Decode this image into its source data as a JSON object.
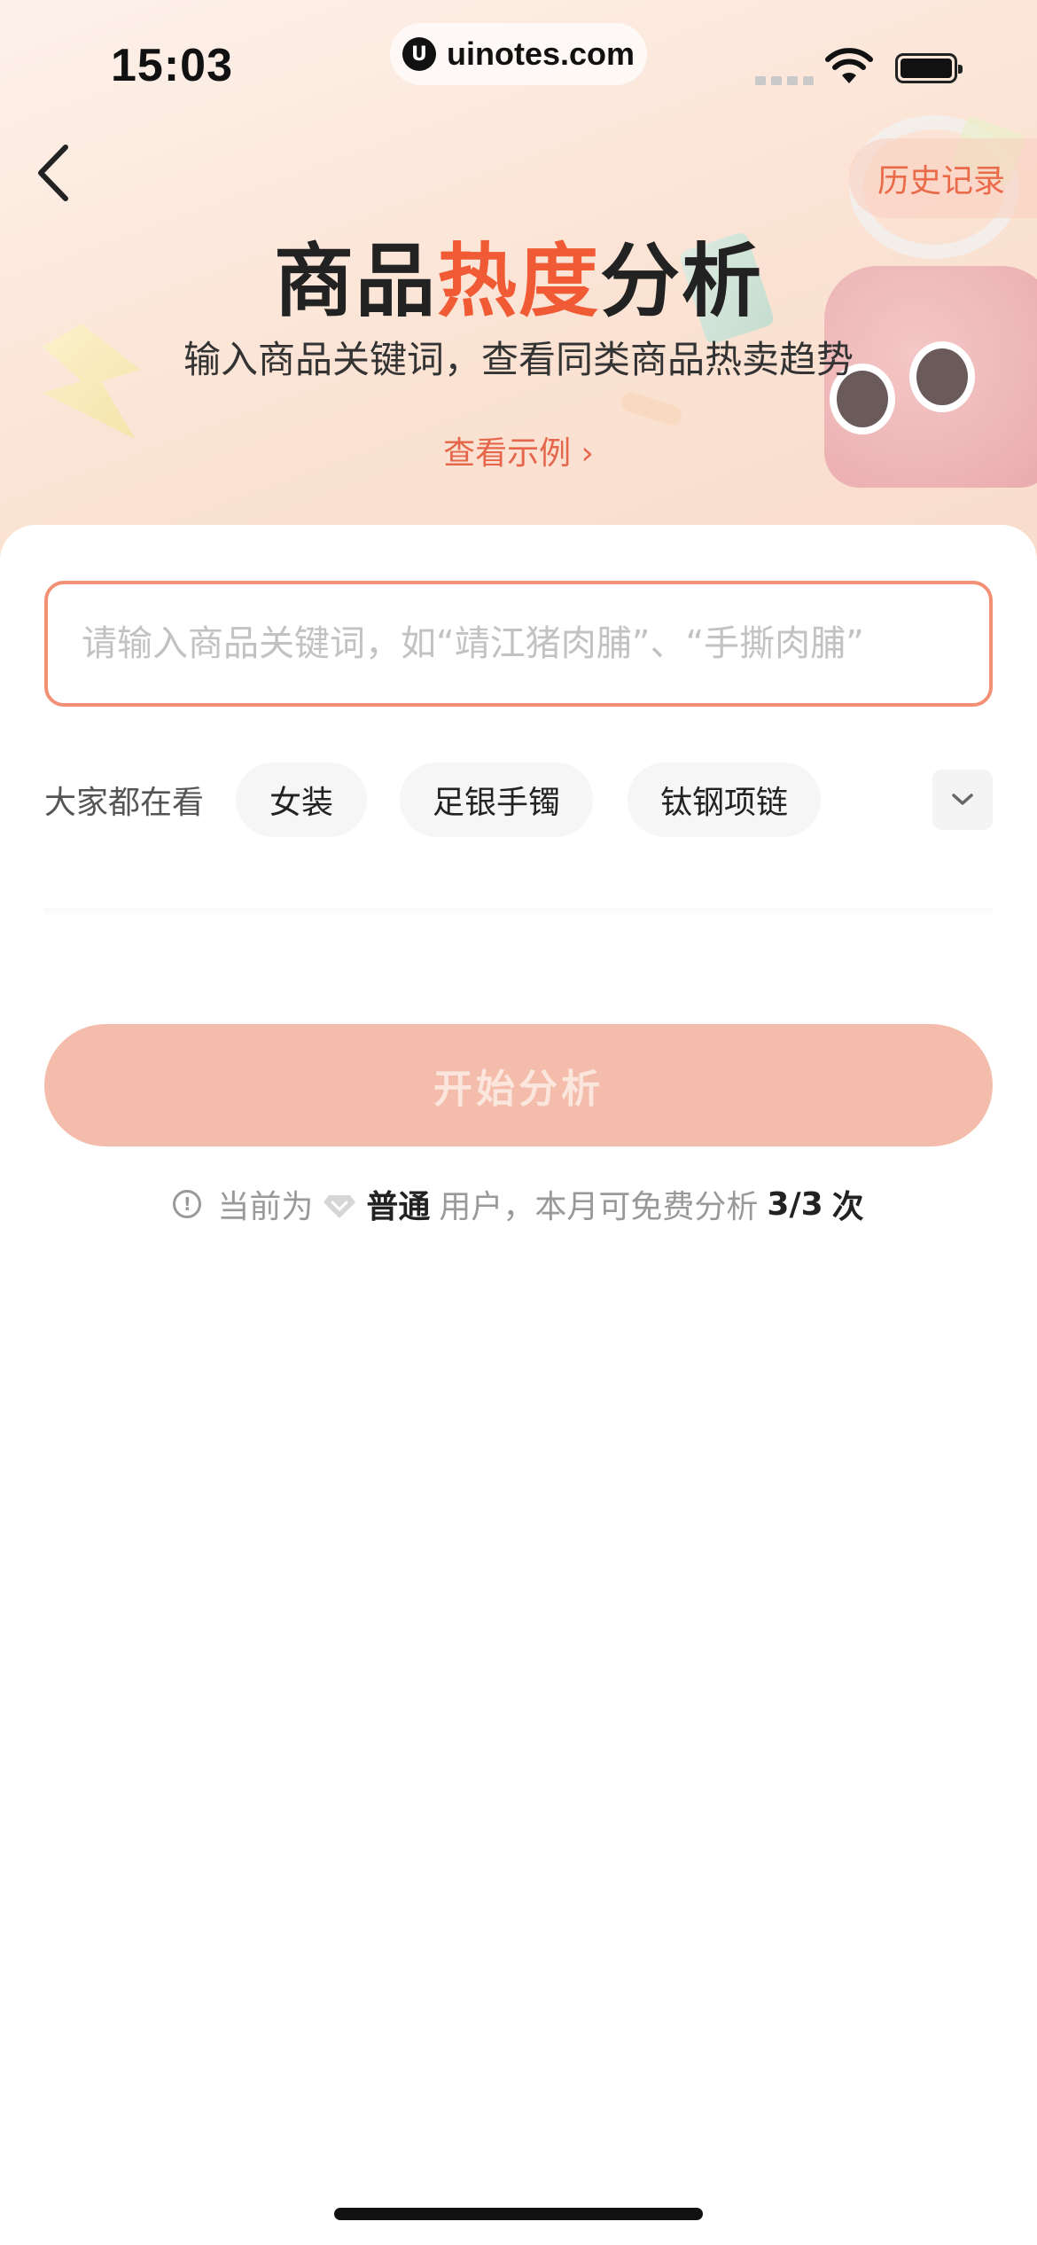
{
  "status_bar": {
    "time": "15:03",
    "url": "uinotes.com",
    "url_icon_letter": "U"
  },
  "header": {
    "back_icon": "chevron-left-icon",
    "history_label": "历史记录"
  },
  "hero": {
    "title_part1": "商品",
    "title_highlight": "热度",
    "title_part2": "分析",
    "subtitle": "输入商品关键词，查看同类商品热卖趋势",
    "example_link": "查看示例",
    "example_arrow": "›"
  },
  "search": {
    "value": "",
    "placeholder": "请输入商品关键词，如“靖江猪肉脯”、“手撕肉脯”"
  },
  "popular": {
    "label": "大家都在看",
    "chips": [
      "女装",
      "足银手镯",
      "钛钢项链"
    ],
    "expand_icon": "chevron-down-icon"
  },
  "actions": {
    "start_label": "开始分析"
  },
  "quota": {
    "prefix": "当前为",
    "level": "普通",
    "middle": "用户，本月可免费分析",
    "count": "3/3",
    "suffix": "次",
    "info_icon": "info-icon",
    "level_icon": "diamond-icon"
  },
  "colors": {
    "accent": "#f05a35",
    "button_disabled": "#f4bcab",
    "input_border": "#f29075"
  }
}
